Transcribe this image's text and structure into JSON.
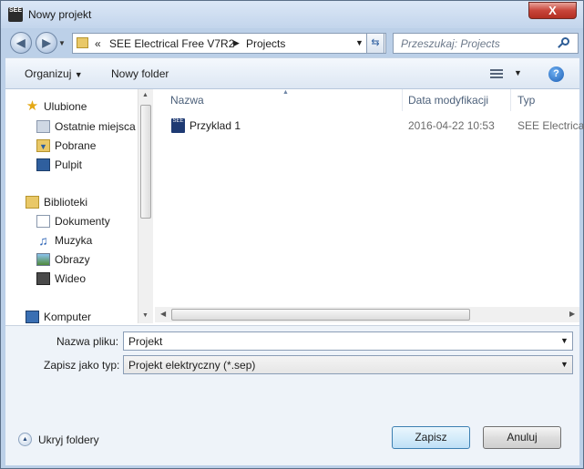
{
  "window": {
    "title": "Nowy projekt",
    "close_label": "X",
    "app_icon_label": "SEE"
  },
  "navigation": {
    "breadcrumb": [
      "«",
      "SEE Electrical Free V7R2",
      "Projects"
    ],
    "search_placeholder": "Przeszukaj: Projects"
  },
  "toolbar": {
    "organize_label": "Organizuj",
    "new_folder_label": "Nowy folder"
  },
  "sidebar": {
    "favorites": {
      "label": "Ulubione",
      "items": [
        {
          "label": "Ostatnie miejsca",
          "icon": "recent-places-icon"
        },
        {
          "label": "Pobrane",
          "icon": "downloads-icon"
        },
        {
          "label": "Pulpit",
          "icon": "desktop-icon"
        }
      ]
    },
    "libraries": {
      "label": "Biblioteki",
      "items": [
        {
          "label": "Dokumenty",
          "icon": "documents-icon"
        },
        {
          "label": "Muzyka",
          "icon": "music-icon"
        },
        {
          "label": "Obrazy",
          "icon": "pictures-icon"
        },
        {
          "label": "Wideo",
          "icon": "video-icon"
        }
      ]
    },
    "computer": {
      "label": "Komputer"
    }
  },
  "file_list": {
    "columns": {
      "name": "Nazwa",
      "date": "Data modyfikacji",
      "type": "Typ"
    },
    "rows": [
      {
        "name": "Przyklad 1",
        "date": "2016-04-22 10:53",
        "type": "SEE Electrica",
        "icon_label": "SEE"
      }
    ]
  },
  "form": {
    "filename_label": "Nazwa pliku:",
    "filename_value": "Projekt",
    "filetype_label": "Zapisz jako typ:",
    "filetype_value": "Projekt elektryczny (*.sep)"
  },
  "footer": {
    "hide_folders_label": "Ukryj foldery",
    "save_label": "Zapisz",
    "cancel_label": "Anuluj"
  },
  "colors": {
    "accent": "#3c7fb1",
    "selection": "#cce8ff"
  }
}
